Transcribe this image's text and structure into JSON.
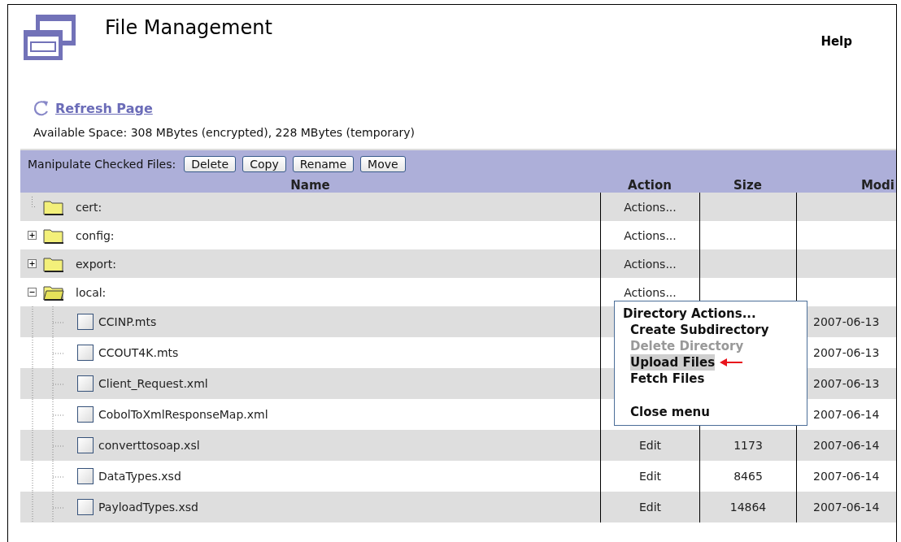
{
  "header": {
    "title": "File Management",
    "help": "Help"
  },
  "refresh": {
    "label": "Refresh Page"
  },
  "available_space": "Available Space: 308 MBytes (encrypted), 228 MBytes (temporary)",
  "toolbar": {
    "label": "Manipulate Checked Files:",
    "buttons": [
      "Delete",
      "Copy",
      "Rename",
      "Move"
    ]
  },
  "table": {
    "columns": [
      "Name",
      "Action",
      "Size",
      "Modi"
    ],
    "rows": [
      {
        "kind": "folder",
        "name": "cert:",
        "action": "Actions..."
      },
      {
        "kind": "folder",
        "name": "config:",
        "action": "Actions...",
        "expanded": false
      },
      {
        "kind": "folder",
        "name": "export:",
        "action": "Actions...",
        "expanded": false
      },
      {
        "kind": "folder",
        "name": "local:",
        "action": "Actions...",
        "expanded": true,
        "menu_open": true,
        "children": [
          {
            "kind": "file",
            "name": "CCINP.mts",
            "checked": false,
            "modified": "2007-06-13"
          },
          {
            "kind": "file",
            "name": "CCOUT4K.mts",
            "checked": false,
            "modified": "2007-06-13"
          },
          {
            "kind": "file",
            "name": "Client_Request.xml",
            "checked": false,
            "modified": "2007-06-13"
          },
          {
            "kind": "file",
            "name": "CobolToXmlResponseMap.xml",
            "checked": false,
            "modified": "2007-06-14"
          },
          {
            "kind": "file",
            "name": "converttosoap.xsl",
            "checked": false,
            "action": "Edit",
            "size": "1173",
            "modified": "2007-06-14"
          },
          {
            "kind": "file",
            "name": "DataTypes.xsd",
            "checked": false,
            "action": "Edit",
            "size": "8465",
            "modified": "2007-06-14"
          },
          {
            "kind": "file",
            "name": "PayloadTypes.xsd",
            "checked": false,
            "action": "Edit",
            "size": "14864",
            "modified": "2007-06-14"
          }
        ]
      }
    ]
  },
  "menu": {
    "title": "Directory Actions...",
    "items": [
      {
        "label": "Create Subdirectory",
        "disabled": false,
        "selected": false,
        "pointer": false
      },
      {
        "label": "Delete Directory",
        "disabled": true,
        "selected": false,
        "pointer": false
      },
      {
        "label": "Upload Files",
        "disabled": false,
        "selected": true,
        "pointer": true
      },
      {
        "label": "Fetch Files",
        "disabled": false,
        "selected": false,
        "pointer": false
      }
    ],
    "close": "Close menu"
  }
}
